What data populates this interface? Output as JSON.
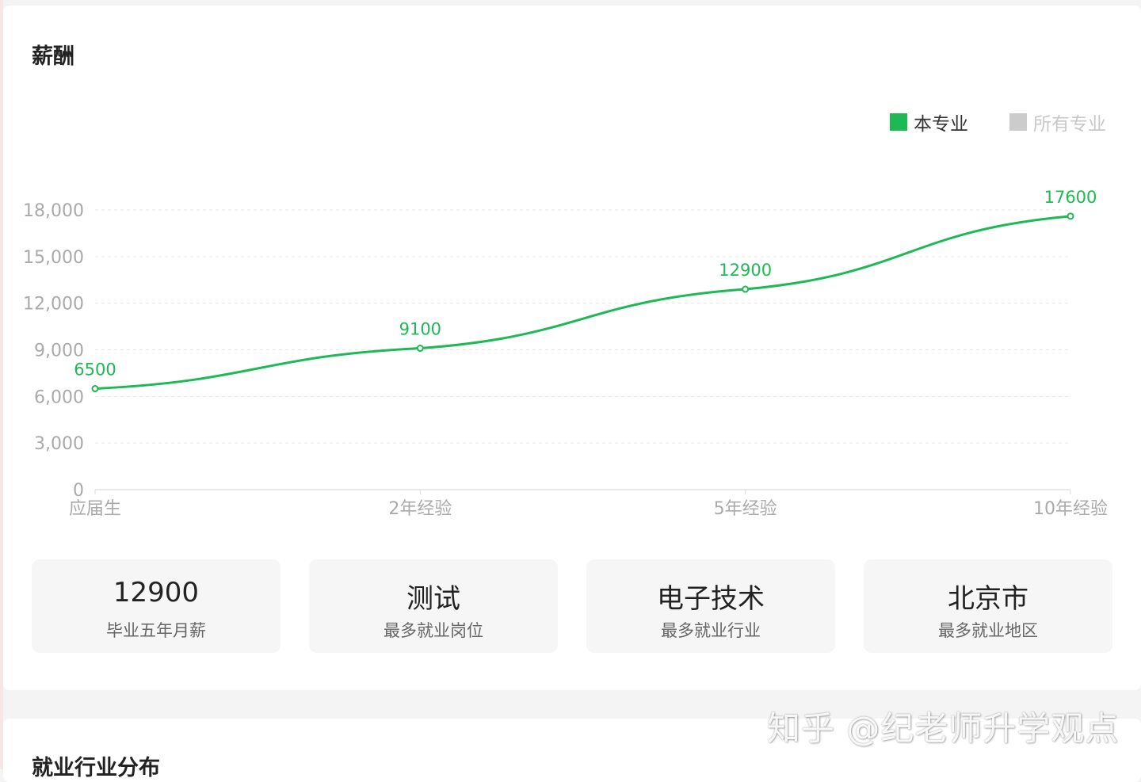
{
  "section": {
    "title": "薪酬"
  },
  "legend": [
    {
      "label": "本专业",
      "color": "#1db954"
    },
    {
      "label": "所有专业",
      "color": "#cccccc"
    }
  ],
  "chart_data": {
    "type": "line",
    "categories": [
      "应届生",
      "2年经验",
      "5年经验",
      "10年经验"
    ],
    "series": [
      {
        "name": "本专业",
        "values": [
          6500,
          9100,
          12900,
          17600
        ],
        "color": "#1db954"
      }
    ],
    "yticks": [
      "0",
      "3,000",
      "6,000",
      "9,000",
      "12,000",
      "15,000",
      "18,000"
    ],
    "ylim": [
      0,
      18000
    ],
    "grid": true,
    "legend_position": "top-right",
    "title": ""
  },
  "stats": [
    {
      "value": "12900",
      "label": "毕业五年月薪"
    },
    {
      "value": "测试",
      "label": "最多就业岗位"
    },
    {
      "value": "电子技术",
      "label": "最多就业行业"
    },
    {
      "value": "北京市",
      "label": "最多就业地区"
    }
  ],
  "next_section": {
    "title": "就业行业分布"
  },
  "watermark": "知乎 @纪老师升学观点"
}
